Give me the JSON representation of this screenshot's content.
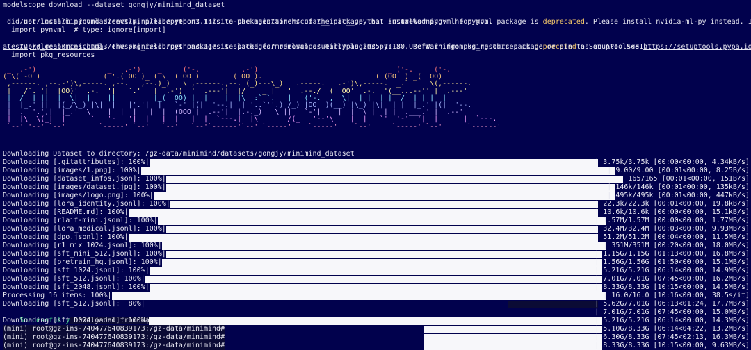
{
  "colors": {
    "background": "#01014d",
    "text": "#e6e6f0",
    "warning": "#f5c86a",
    "success": "#35d07f",
    "progress_fill": "#f7f7fa"
  },
  "header_lines": [
    {
      "text": "modelscope download --dataset gongjy/minimind_dataset"
    },
    {
      "text": "/usr/local/miniconda3/envs/mini/lib/python3.11/site-packages/torch/cuda/__init__.py:61: FutureWarning: The pynvml package is deprecated. Please install nvidia-ml-py instead. If you"
    },
    {
      "text": " did not install pynvml directly, please report this to the maintainers of the package that installed pynvml for you."
    },
    {
      "text": "  import pynvml  # type: ignore[import]"
    },
    {
      "text": "/usr/local/miniconda3/envs/mini/lib/python3.11/site-packages/modelscope/utils/plugins.py:18: UserWarning: pkg_resources is deprecated as an API. See https://setuptools.pypa.io/en/l"
    },
    {
      "text": "atest/pkg_resources.html. The pkg_resources package is slated for removal as early as 2025-11-30. Refrain from using this package or pin to Setuptools<81."
    },
    {
      "text": "  import pkg_resources"
    }
  ],
  "banner": [
    " _  .-')                 _   .-')    _     ('-.          .-')                               _ ('-.     ('-.",
    "( \\( -O )               ( '.( OO )_ ( \\  ( OO )        ( OO ).                           ( (OO  ) _(  OO)",
    " ,------. ,--.-')\\,-----. ,--.   ,--.)_)   \\ ,------.,--. (_)---\\_)   .-----.   .-')\\,-----.  _.`     \\(,------.",
    " |   /`. '|  |OO)'  .-.  '|   `.'   |  .-')  '  .---'|  |/    _ |   '  .--./  (  OO'  .-.  '(__...--'' |  .---'",
    " |  /  | ||  |  \\|  | |  ||         |_(  OO) |  |    |  |\\  :` `.   |  |('-.  ,  \\|  | |  | |  /  | | |  |",
    " |  |_.' ||  |(_/\\_) |\\|  ||  |'.'|  |   `-' |(|  '--.|  | '..`''.) /_) |OO  )(__) |\\_) |\\|  | |  |_.' |(|  '--.",
    " |  .  '.',|  |_.'  \\ |  | ||  |   |  |  (OOO |  .--'|  |.-._)   \\ ||  |`-'|    |  |  \\ |  | |  .___.' |  .--'",
    " |  |\\  \\(_|  |      `'  '-'  '|  |   |  |   |  |  `---.|  |\\       /(_'  '--'\\    |  |   `'  '-'  '|  |      |  `---.",
    " `--' '--' `--'        `-----' `--'   `--'   `--'`------'`--' `-----'    `-----'    `--'     `-----' `--'      `------'"
  ],
  "download_dir_line": "Downloading Dataset to directory: /gz-data/minimind/datasets/gongjy/minimind_dataset",
  "progress_rows": [
    {
      "left": "Downloading [.gitattributes]: 100%|",
      "fill": 1.0,
      "right": "| 3.75k/3.75k [00:00<00:00, 4.34kB/s]"
    },
    {
      "left": "Downloading [images/1.png]: 100%|",
      "fill": 1.0,
      "right": "| 9.00/9.00 [00:01<00:00, 8.25B/s]"
    },
    {
      "left": "Downloading [dataset_infos.json]: 100%|",
      "fill": 1.0,
      "right": "| 165/165 [00:01<00:00, 151B/s]"
    },
    {
      "left": "Downloading [images/dataset.jpg]: 100%|",
      "fill": 1.0,
      "right": "| 146k/146k [00:01<00:00, 135kB/s]"
    },
    {
      "left": "Downloading [images/logo.png]: 100%|",
      "fill": 1.0,
      "right": "| 495k/495k [00:01<00:00, 447kB/s]"
    },
    {
      "left": "Downloading [lora_identity.jsonl]: 100%|",
      "fill": 1.0,
      "right": "| 22.3k/22.3k [00:01<00:00, 19.8kB/s]"
    },
    {
      "left": "Downloading [README.md]: 100%|",
      "fill": 1.0,
      "right": "| 10.6k/10.6k [00:00<00:00, 15.1kB/s]"
    },
    {
      "left": "Downloading [rlaif-mini.jsonl]: 100%|",
      "fill": 1.0,
      "right": "| 1.57M/1.57M [00:00<00:00, 1.77MB/s]"
    },
    {
      "left": "Downloading [lora_medical.jsonl]: 100%|",
      "fill": 1.0,
      "right": "| 32.4M/32.4M [00:03<00:00, 9.93MB/s]"
    },
    {
      "left": "Downloading [dpo.jsonl]: 100%|",
      "fill": 1.0,
      "right": "| 51.2M/51.2M [00:04<00:00, 11.5MB/s]"
    },
    {
      "left": "Downloading [r1_mix_1024.jsonl]: 100%|",
      "fill": 1.0,
      "right": "| 351M/351M [00:20<00:00, 18.0MB/s]"
    },
    {
      "left": "Downloading [sft_mini_512.jsonl]: 100%|",
      "fill": 1.0,
      "right": "| 1.15G/1.15G [01:13<00:00, 16.8MB/s]"
    },
    {
      "left": "Downloading [pretrain_hq.jsonl]: 100%|",
      "fill": 1.0,
      "right": "| 1.56G/1.56G [01:50<00:00, 15.1MB/s]"
    },
    {
      "left": "Downloading [sft_1024.jsonl]: 100%|",
      "fill": 1.0,
      "right": "| 5.21G/5.21G [06:14<00:00, 14.9MB/s]"
    },
    {
      "left": "Downloading [sft_512.jsonl]: 100%|",
      "fill": 1.0,
      "right": "| 7.01G/7.01G [07:45<00:00, 16.2MB/s]"
    },
    {
      "left": "Downloading [sft_2048.jsonl]: 100%|",
      "fill": 1.0,
      "right": "| 8.33G/8.33G [10:15<00:00, 14.5MB/s]"
    },
    {
      "left": "Processing 16 items: 100%|",
      "fill": 1.0,
      "right": "| 16.0/16.0 [10:16<00:00, 38.5s/it]"
    },
    {
      "left": "Downloading [sft_512.jsonl]:  80%|",
      "fill": 0.8,
      "right": "| 5.62G/7.01G [06:13<01:24, 17.7MB/s]"
    }
  ],
  "success_line": {
    "prefix": "Successfully",
    "text": " Downloaded from dataset gongjy/minimind_dataset.",
    "right": "| 7.01G/7.01G [07:45<00:00, 15.0MB/s]"
  },
  "after_rows": [
    {
      "left": "Downloading [sft_1024.jsonl]: 100%|",
      "fill": 1.0,
      "right": "| 5.21G/5.21G [06:14<00:00, 14.3MB/s]"
    },
    {
      "left": "(mini) root@gz-ins-740477640839173:/gz-data/minimind#",
      "fill": 1.0,
      "right": "| 5.10G/8.33G [06:14<04:22, 13.2MB/s]"
    },
    {
      "left": "(mini) root@gz-ins-740477640839173:/gz-data/minimind#",
      "fill": 1.0,
      "right": "| 6.30G/8.33G [07:45<02:13, 16.3MB/s]"
    },
    {
      "left": "(mini) root@gz-ins-740477640839173:/gz-data/minimind#",
      "fill": 1.0,
      "right": "| 8.33G/8.33G [10:15<00:00, 9.63MB/s]"
    }
  ]
}
